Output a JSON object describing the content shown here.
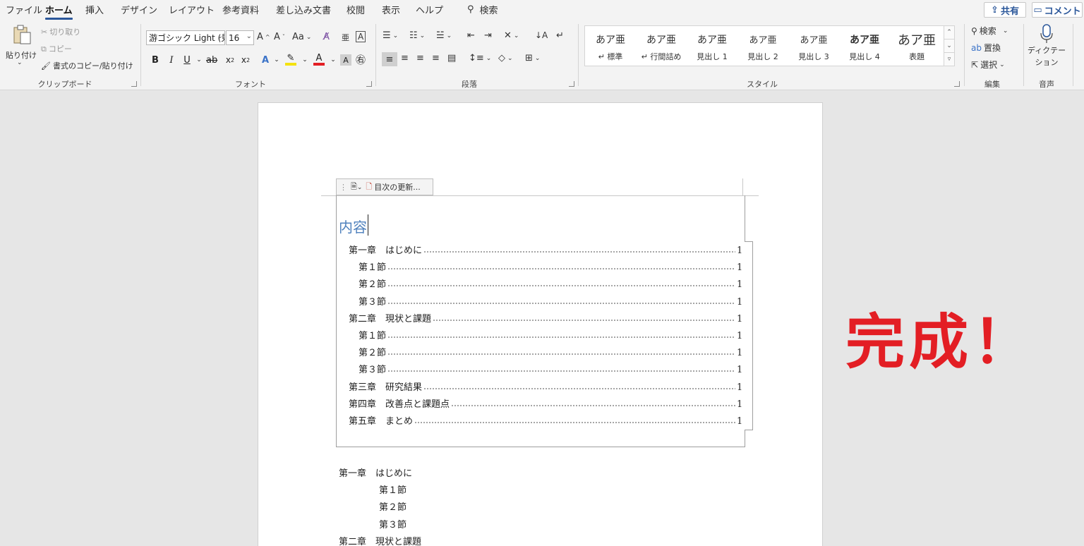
{
  "menu": {
    "tabs": [
      "ファイル",
      "ホーム",
      "挿入",
      "デザイン",
      "レイアウト",
      "参考資料",
      "差し込み文書",
      "校閲",
      "表示",
      "ヘルプ"
    ],
    "search_label": "検索",
    "share_label": "共有",
    "comment_label": "コメント"
  },
  "ribbon": {
    "clipboard": {
      "paste": "貼り付け",
      "cut": "切り取り",
      "copy": "コピー",
      "format_painter": "書式のコピー/貼り付け",
      "label": "クリップボード"
    },
    "font": {
      "family": "游ゴシック Light (見",
      "size": "16",
      "label": "フォント"
    },
    "paragraph": {
      "label": "段落"
    },
    "styles": {
      "label": "スタイル",
      "items": [
        {
          "sample": "あア亜",
          "name": "↵ 標準"
        },
        {
          "sample": "あア亜",
          "name": "↵ 行間詰め"
        },
        {
          "sample": "あア亜",
          "name": "見出し 1"
        },
        {
          "sample": "あア亜",
          "name": "見出し 2"
        },
        {
          "sample": "あア亜",
          "name": "見出し 3"
        },
        {
          "sample": "あア亜",
          "name": "見出し 4"
        },
        {
          "sample": "あア亜",
          "name": "表題"
        }
      ]
    },
    "editing": {
      "find": "検索",
      "replace": "置換",
      "select": "選択",
      "label": "編集"
    },
    "voice": {
      "dictate_line1": "ディクテー",
      "dictate_line2": "ション",
      "label": "音声"
    }
  },
  "document": {
    "toc_update_label": "目次の更新...",
    "toc_title": "内容",
    "toc_entries": [
      {
        "text": "第一章　はじめに",
        "page": "1",
        "level": 1
      },
      {
        "text": "第１節",
        "page": "1",
        "level": 2
      },
      {
        "text": "第２節",
        "page": "1",
        "level": 2
      },
      {
        "text": "第３節",
        "page": "1",
        "level": 2
      },
      {
        "text": "第二章　現状と課題",
        "page": "1",
        "level": 1
      },
      {
        "text": "第１節",
        "page": "1",
        "level": 2
      },
      {
        "text": "第２節",
        "page": "1",
        "level": 2
      },
      {
        "text": "第３節",
        "page": "1",
        "level": 2
      },
      {
        "text": "第三章　研究結果",
        "page": "1",
        "level": 1
      },
      {
        "text": "第四章　改善点と課題点",
        "page": "1",
        "level": 1
      },
      {
        "text": "第五章　まとめ",
        "page": "1",
        "level": 1
      }
    ],
    "body_lines": [
      {
        "text": "第一章　はじめに",
        "level": 1
      },
      {
        "text": "第１節",
        "level": 2
      },
      {
        "text": "第２節",
        "level": 2
      },
      {
        "text": "第３節",
        "level": 2
      },
      {
        "text": "第二章　現状と課題",
        "level": 1
      }
    ]
  },
  "overlay": {
    "done_text": "完成！",
    "color": "#e31e24"
  },
  "colors": {
    "accent": "#2b579a",
    "heading_blue": "#4f81bd"
  }
}
